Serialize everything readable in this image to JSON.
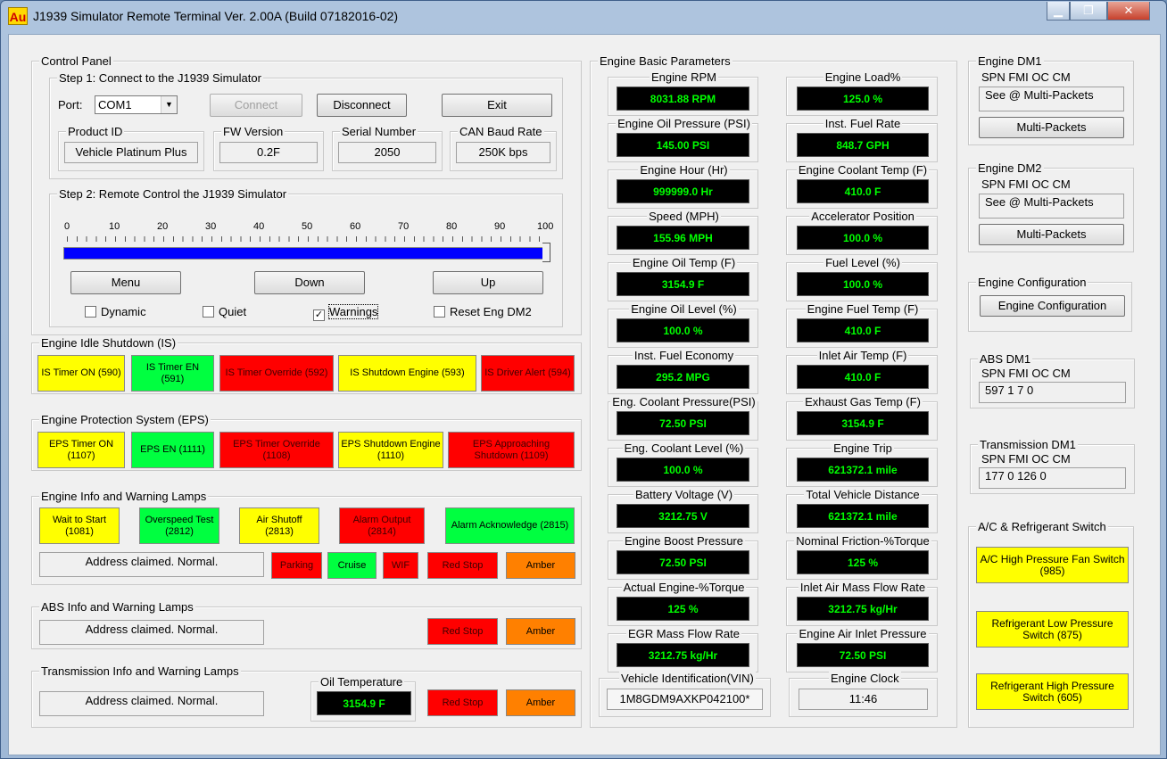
{
  "window": {
    "title": "J1939 Simulator Remote Terminal Ver. 2.00A (Build 07182016-02)",
    "icon_text": "Au",
    "min": "▁",
    "max": "❐",
    "close": "✕"
  },
  "control_panel": {
    "title": "Control Panel",
    "step1": {
      "title": "Step 1: Connect to the J1939 Simulator",
      "port_label": "Port:",
      "port_value": "COM1",
      "connect": "Connect",
      "disconnect": "Disconnect",
      "exit": "Exit",
      "product_id_label": "Product ID",
      "product_id": "Vehicle Platinum Plus",
      "fw_label": "FW Version",
      "fw": "0.2F",
      "serial_label": "Serial Number",
      "serial": "2050",
      "baud_label": "CAN Baud Rate",
      "baud": "250K bps"
    },
    "step2": {
      "title": "Step 2: Remote Control the J1939 Simulator",
      "ticks": [
        "0",
        "10",
        "20",
        "30",
        "40",
        "50",
        "60",
        "70",
        "80",
        "90",
        "100"
      ],
      "slider_value": 100,
      "menu": "Menu",
      "down": "Down",
      "up": "Up",
      "dynamic": "Dynamic",
      "quiet": "Quiet",
      "warnings": "Warnings",
      "reset": "Reset Eng DM2",
      "dynamic_checked": false,
      "quiet_checked": false,
      "warnings_checked": true,
      "reset_checked": false,
      "checkmark": "✓"
    }
  },
  "idle_shutdown": {
    "title": "Engine Idle Shutdown (IS)",
    "lamps": [
      "IS Timer ON (590)",
      "IS Timer EN (591)",
      "IS Timer Override (592)",
      "IS Shutdown Engine (593)",
      "IS Driver Alert (594)"
    ]
  },
  "eps": {
    "title": "Engine Protection System (EPS)",
    "lamps": [
      "EPS Timer ON (1107)",
      "EPS EN (1111)",
      "EPS Timer Override (1108)",
      "EPS Shutdown Engine (1110)",
      "EPS Approaching Shutdown (1109)"
    ]
  },
  "engine_info": {
    "title": "Engine Info and Warning Lamps",
    "lamps": [
      "Wait to Start (1081)",
      "Overspeed Test (2812)",
      "Air Shutoff (2813)",
      "Alarm Output (2814)",
      "Alarm Acknowledge (2815)"
    ],
    "status": "Address claimed. Normal.",
    "small_lamps": [
      "Parking",
      "Cruise",
      "WIF",
      "Red Stop",
      "Amber"
    ]
  },
  "abs_info": {
    "title": "ABS Info and Warning Lamps",
    "status": "Address claimed. Normal.",
    "lamps": [
      "Red Stop",
      "Amber"
    ]
  },
  "trans_info": {
    "title": "Transmission Info and Warning Lamps",
    "status": "Address claimed. Normal.",
    "oil_label": "Oil Temperature",
    "oil_value": "3154.9 F",
    "lamps": [
      "Red Stop",
      "Amber"
    ]
  },
  "basic": {
    "title": "Engine Basic Parameters",
    "left": [
      {
        "label": "Engine RPM",
        "value": "8031.88 RPM"
      },
      {
        "label": "Engine Oil Pressure (PSI)",
        "value": "145.00 PSI"
      },
      {
        "label": "Engine Hour (Hr)",
        "value": "999999.0 Hr"
      },
      {
        "label": "Speed (MPH)",
        "value": "155.96 MPH"
      },
      {
        "label": "Engine Oil Temp (F)",
        "value": "3154.9 F"
      },
      {
        "label": "Engine Oil Level (%)",
        "value": "100.0 %"
      },
      {
        "label": "Inst. Fuel Economy",
        "value": "295.2 MPG"
      },
      {
        "label": "Eng. Coolant Pressure(PSI)",
        "value": "72.50 PSI"
      },
      {
        "label": "Eng. Coolant Level (%)",
        "value": "100.0 %"
      },
      {
        "label": "Battery Voltage (V)",
        "value": "3212.75 V"
      },
      {
        "label": "Engine Boost Pressure",
        "value": "72.50 PSI"
      },
      {
        "label": "Actual Engine-%Torque",
        "value": "125 %"
      },
      {
        "label": "EGR Mass Flow Rate",
        "value": "3212.75 kg/Hr"
      }
    ],
    "right": [
      {
        "label": "Engine Load%",
        "value": "125.0 %"
      },
      {
        "label": "Inst. Fuel Rate",
        "value": "848.7 GPH"
      },
      {
        "label": "Engine Coolant Temp (F)",
        "value": "410.0 F"
      },
      {
        "label": "Accelerator Position",
        "value": "100.0 %"
      },
      {
        "label": "Fuel Level (%)",
        "value": "100.0 %"
      },
      {
        "label": "Engine Fuel Temp (F)",
        "value": "410.0 F"
      },
      {
        "label": "Inlet Air Temp (F)",
        "value": "410.0 F"
      },
      {
        "label": "Exhaust Gas Temp (F)",
        "value": "3154.9 F"
      },
      {
        "label": "Engine Trip",
        "value": "621372.1 mile"
      },
      {
        "label": "Total Vehicle Distance",
        "value": "621372.1 mile"
      },
      {
        "label": "Nominal Friction-%Torque",
        "value": "125 %"
      },
      {
        "label": "Inlet Air Mass Flow Rate",
        "value": "3212.75 kg/Hr"
      },
      {
        "label": "Engine Air Inlet Pressure",
        "value": "72.50 PSI"
      }
    ],
    "vin_label": "Vehicle Identification(VIN)",
    "vin": "1M8GDM9AXKP042100*",
    "clock_label": "Engine Clock",
    "clock": "11:46"
  },
  "dm": {
    "header": "SPN  FMI  OC  CM",
    "dm1": {
      "title": "Engine DM1",
      "value": "See @ Multi-Packets",
      "button": "Multi-Packets"
    },
    "dm2": {
      "title": "Engine DM2",
      "value": "See @ Multi-Packets",
      "button": "Multi-Packets"
    },
    "config": {
      "title": "Engine Configuration",
      "button": "Engine Configuration"
    },
    "abs": {
      "title": "ABS DM1",
      "value": "597    1    7    0"
    },
    "trans": {
      "title": "Transmission DM1",
      "value": "177    0    126    0"
    }
  },
  "ac": {
    "title": "A/C & Refrigerant Switch",
    "lamps": [
      "A/C High Pressure Fan Switch (985)",
      "Refrigerant Low Pressure Switch (875)",
      "Refrigerant High Pressure Switch (605)"
    ]
  }
}
